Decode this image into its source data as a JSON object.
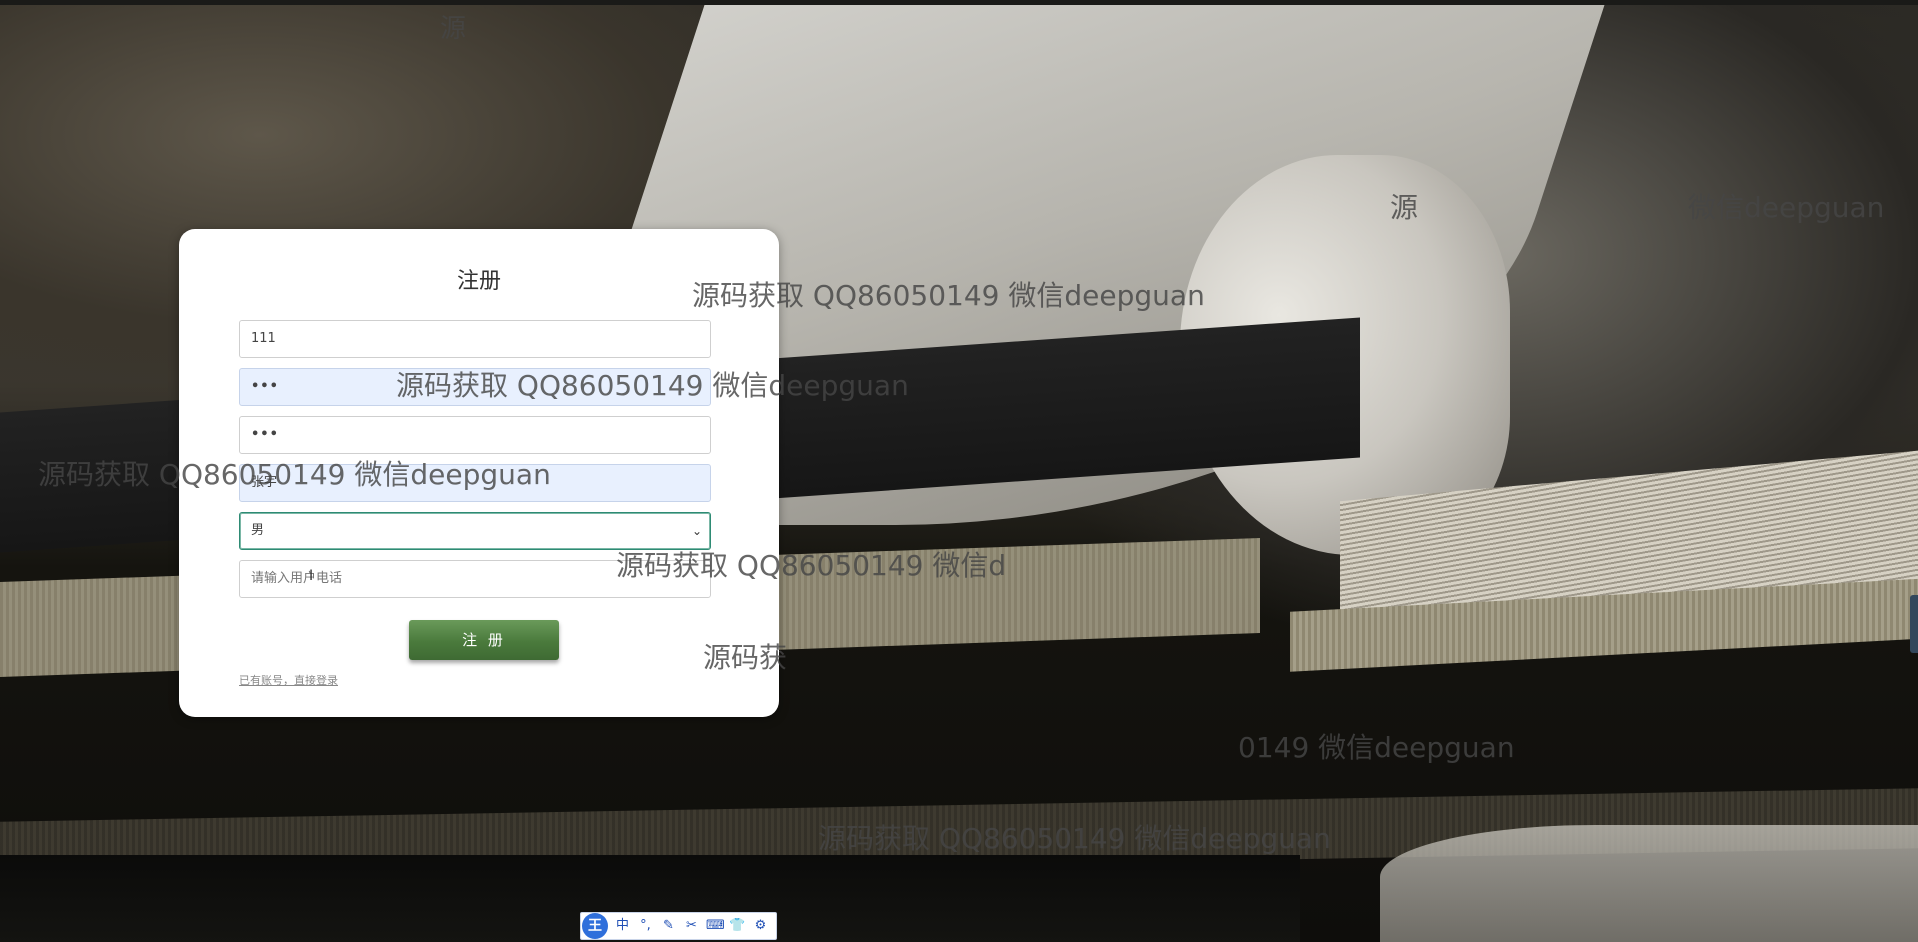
{
  "register": {
    "title": "注册",
    "username_value": "111",
    "password_value": "•••",
    "confirm_password_value": "•••",
    "name_value": "张宇",
    "gender_selected": "男",
    "phone_placeholder": "请输入用户电话",
    "submit_label": "注 册",
    "login_link": "已有账号，直接登录"
  },
  "watermark_text": "源码获取 QQ86050149 微信deepguan",
  "watermark_fragments": {
    "top": "源",
    "top_right": "源",
    "top_right_tail": "微信deepguan",
    "lower_mid": "源码获取 QQ86050149 微信d",
    "card_right": "源码获",
    "bottom_right": "0149 微信deepguan",
    "bottom": "源码获取 QQ86050149 微信deepguan"
  },
  "ime_toolbar": {
    "logo": "王",
    "items": [
      "中",
      "°,",
      "✎",
      "✂",
      "⌨",
      "👕",
      "⚙"
    ]
  },
  "colors": {
    "card_bg": "#ffffff",
    "autofill_bg": "#e8f0fe",
    "button_green": "#4a7a3c",
    "select_border": "#2e8b74",
    "ime_blue": "#2f6fdb"
  }
}
